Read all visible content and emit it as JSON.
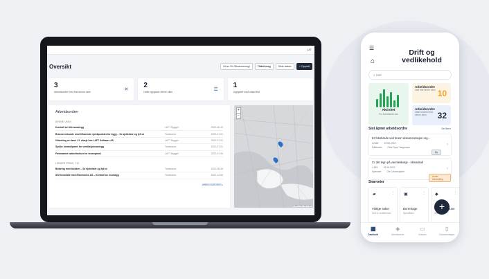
{
  "colors": {
    "accent": "#1e2a3c",
    "green": "#24a457",
    "orange": "#f5a21b",
    "blue": "#2f6fc8"
  },
  "laptop": {
    "topbar_right": "LAT",
    "page_title": "Oversikt",
    "actions": {
      "scan": "Ut av. Dir Skoavmening!",
      "period": "Tildelt meg",
      "filter": "Siste datoer",
      "new": "Opprett"
    },
    "stats": [
      {
        "value": "3",
        "label": "Arbeidsordrer med frist denne uken",
        "icon": "tools-icon"
      },
      {
        "value": "2",
        "label": "Hofte oppgaver denne uken",
        "icon": "list-icon"
      },
      {
        "value": "1",
        "label": "Oppgaver med utløpt frist",
        "icon": "clock-icon"
      }
    ],
    "orders": {
      "title": "Arbeidsordrer",
      "group1": "DENNE UKEN",
      "rows1": [
        {
          "title": "Kontroll av frifressanlegg",
          "category": "LAFT Bygget",
          "date": "2022-06-10"
        },
        {
          "title": "Brannvernkunde med tilhørende sjekkpunkter for bygg – Se sjekkliste og fyll ut",
          "category": "Tomtearea",
          "date": "2022-07-01"
        },
        {
          "title": "Utbedring av dører i 3. etasje hos LAFT Software AS",
          "category": "LAFT Bygget",
          "date": "2022-07-01"
        },
        {
          "title": "Sjekke kontrollpanel for ventilasjonsanlegg",
          "category": "Tomtearea",
          "date": "2022-07-01"
        },
        {
          "title": "Fastmøntet nøkkelbokser for brannpanel",
          "category": "LAFT Bygget",
          "date": "2022-07-06"
        }
      ],
      "group2": "LENGER FREM I TID",
      "rows2": [
        {
          "title": "Befaring med blokken – Se sjekkliste og fyll ut",
          "category": "Tomtearea",
          "date": "2022-08-08"
        },
        {
          "title": "Serviceavtale med Electronics AS – Kontroll av el-anlegg",
          "category": "Tomtearea",
          "date": "2022-10-06"
        }
      ],
      "more_link": "ARBEIDSORDRER ▸"
    },
    "map": {
      "zoom_in": "+",
      "zoom_out": "−",
      "attribution": "Leaflet | Kart: Kartverket"
    }
  },
  "phone": {
    "title_line1": "Drift og",
    "title_line2": "vedlikehold",
    "search_placeholder": "Søk",
    "tile_green": {
      "label": "Aktivitet",
      "sub": "For kommende uke"
    },
    "tile_orange": {
      "label": "Arbeidsordre",
      "sub": "med frist denne uken",
      "value": "10"
    },
    "tile_blue": {
      "label": "Arbeidsordre",
      "sub": "utført innenfor frist denne uken",
      "value": "32"
    },
    "recent_title": "Sist åpnet arbeidsordre",
    "recent_link": "Se flere",
    "cards": [
      {
        "title": "Er fekobrede ved brann dokumentasjon org...",
        "id": "12345",
        "date": "19.06.2022",
        "place": "Rådhuset",
        "person": "Pete Opsl. Jørgensen",
        "status": "Ny"
      },
      {
        "title": "Cr det tegn på vannlekkasje - klimaskall",
        "id": "4.891",
        "date": "19.06.2022",
        "place": "Sjøhuset",
        "person": "Ole Lohansplanfi",
        "status": "Under behandling"
      }
    ],
    "shortcuts_title": "Snarveier",
    "shortcuts": [
      {
        "icon": "folder-icon",
        "label": "Viktige saker",
        "sub": "Drift & vedlikehold"
      },
      {
        "icon": "calendar-icon",
        "label": "Borrehage",
        "sub": "Spesifikke"
      },
      {
        "icon": "layers-icon",
        "label": "Oslo kommune",
        "sub": "Arkiv"
      }
    ],
    "fab": "+",
    "tabs": [
      {
        "icon": "▦",
        "label": "Dashbord",
        "active": true
      },
      {
        "icon": "◈",
        "label": "Arbeidsordre",
        "active": false
      },
      {
        "icon": "▭",
        "label": "Innboks",
        "active": false
      },
      {
        "icon": "▯",
        "label": "Dokumentasjon",
        "active": false
      }
    ]
  }
}
